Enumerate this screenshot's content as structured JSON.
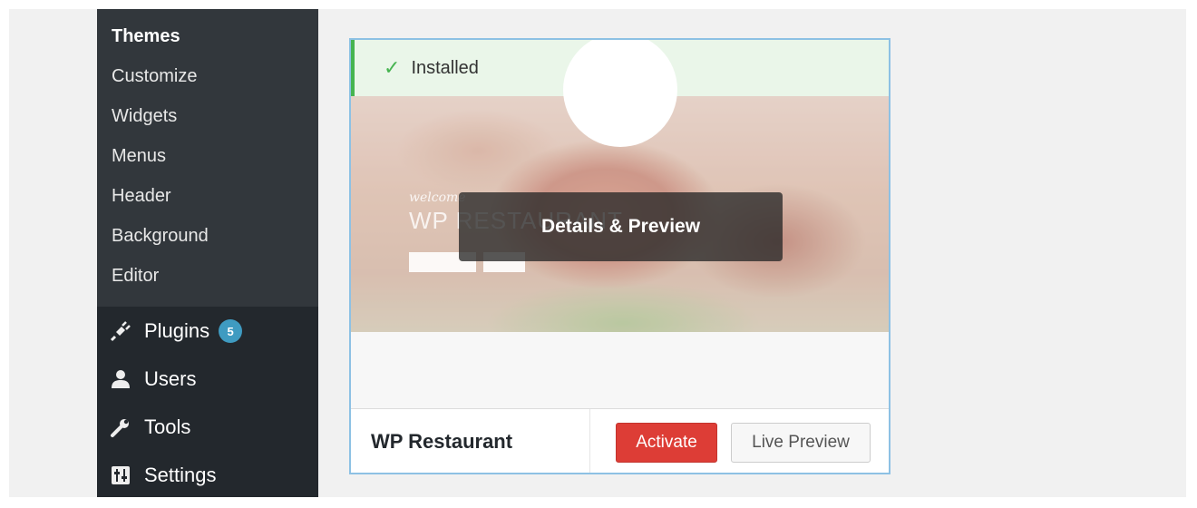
{
  "sidebar": {
    "submenu": [
      {
        "label": "Themes",
        "current": true
      },
      {
        "label": "Customize"
      },
      {
        "label": "Widgets"
      },
      {
        "label": "Menus"
      },
      {
        "label": "Header"
      },
      {
        "label": "Background"
      },
      {
        "label": "Editor"
      }
    ],
    "menu": [
      {
        "label": "Plugins",
        "icon": "plugins-icon",
        "badge": "5"
      },
      {
        "label": "Users",
        "icon": "users-icon"
      },
      {
        "label": "Tools",
        "icon": "tools-icon"
      },
      {
        "label": "Settings",
        "icon": "settings-icon"
      }
    ]
  },
  "theme_card": {
    "status_text": "Installed",
    "overlay_label": "Details & Preview",
    "preview_heading": "WP RESTAURANT",
    "preview_welcome": "welcome",
    "name": "WP Restaurant",
    "activate_label": "Activate",
    "live_preview_label": "Live Preview"
  },
  "colors": {
    "sidebar_bg": "#23282d",
    "submenu_bg": "#32373c",
    "badge": "#3f9bc1",
    "success": "#46b450",
    "activate": "#dd3d36",
    "card_border": "#8dc1e4"
  }
}
